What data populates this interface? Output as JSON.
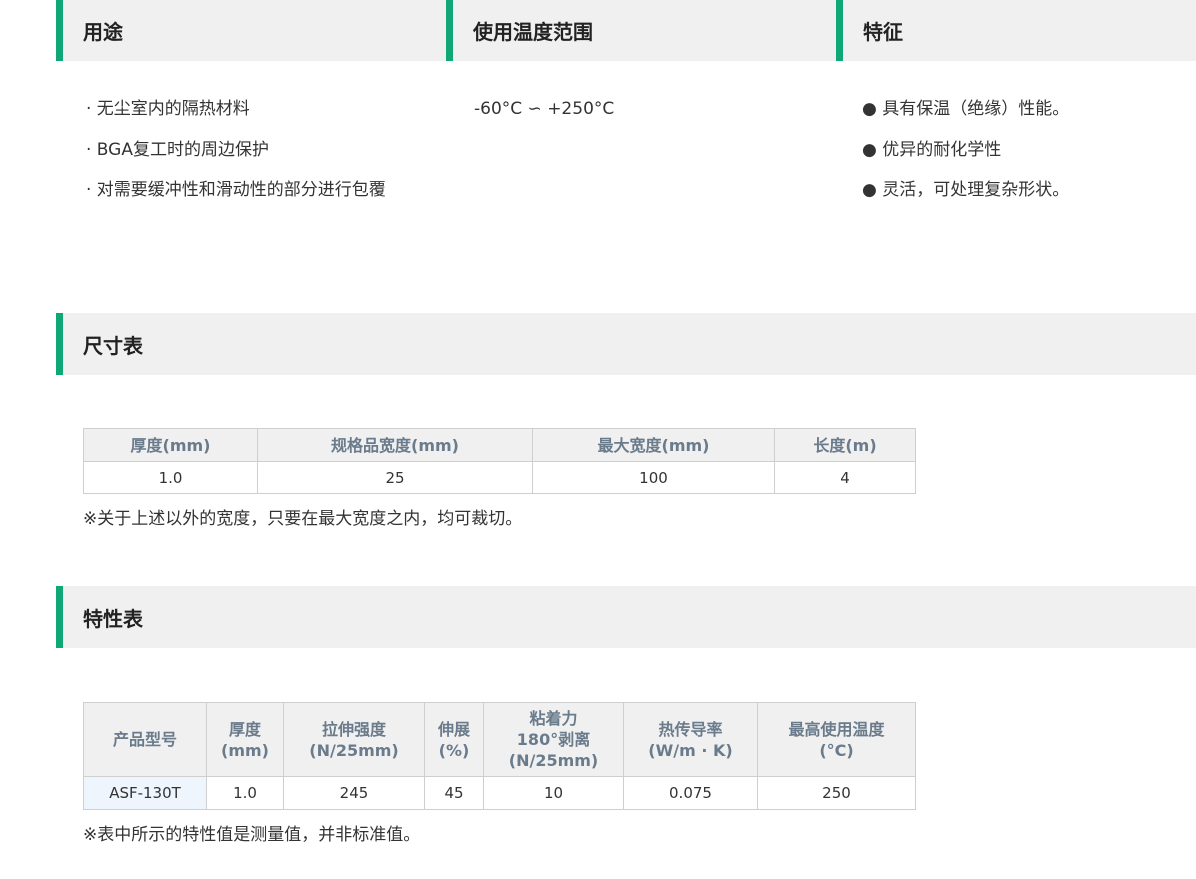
{
  "usage": {
    "title": "用途",
    "items": [
      "· 无尘室内的隔热材料",
      "· BGA复工时的周边保护",
      "· 对需要缓冲性和滑动性的部分进行包覆"
    ]
  },
  "temperature": {
    "title": "使用温度范围",
    "value": "-60°C ∽ +250°C"
  },
  "features": {
    "title": "特征",
    "items": [
      "● 具有保温（绝缘）性能。",
      "● 优异的耐化学性",
      "● 灵活，可处理复杂形状。"
    ]
  },
  "size_section": {
    "title": "尺寸表",
    "headers": [
      "厚度(mm)",
      "规格品宽度(mm)",
      "最大宽度(mm)",
      "长度(m)"
    ],
    "row": [
      "1.0",
      "25",
      "100",
      "4"
    ],
    "note": "※关于上述以外的宽度，只要在最大宽度之内，均可裁切。"
  },
  "property_section": {
    "title": "特性表",
    "headers": [
      "产品型号",
      "厚度\n(mm)",
      "拉伸强度\n(N/25mm)",
      "伸展\n(%)",
      "粘着力\n180°剥离\n(N/25mm)",
      "热传导率\n(W/m · K)",
      "最高使用温度\n(°C)"
    ],
    "row": [
      "ASF-130T",
      "1.0",
      "245",
      "45",
      "10",
      "0.075",
      "250"
    ],
    "note": "※表中所示的特性值是测量值，并非标准值。"
  },
  "colors": {
    "accent": "#10a777",
    "header_bg": "#f0f0f0",
    "table_header_text": "#6a7b8c",
    "model_cell_bg": "#eef5fc"
  }
}
